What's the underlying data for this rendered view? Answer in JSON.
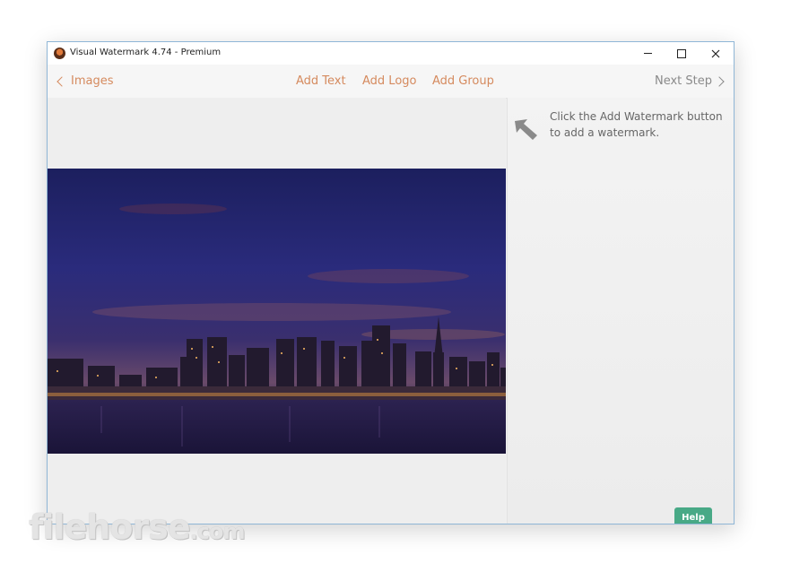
{
  "window": {
    "title": "Visual Watermark 4.74 - Premium"
  },
  "toolbar": {
    "back_label": "Images",
    "add_text": "Add Text",
    "add_logo": "Add Logo",
    "add_group": "Add Group",
    "next_step": "Next Step"
  },
  "side_panel": {
    "hint": "Click the Add Watermark button to add a watermark.",
    "help_label": "Help"
  },
  "watermark": {
    "brand": "filehorse",
    "tld": ".com"
  },
  "colors": {
    "accent": "#d58a5e",
    "help_button": "#48a986",
    "window_border": "#8fb6d6"
  },
  "icons": {
    "back": "chevron-left-icon",
    "next": "chevron-right-icon",
    "hint": "arrow-up-left-icon",
    "app": "app-logo-icon"
  }
}
